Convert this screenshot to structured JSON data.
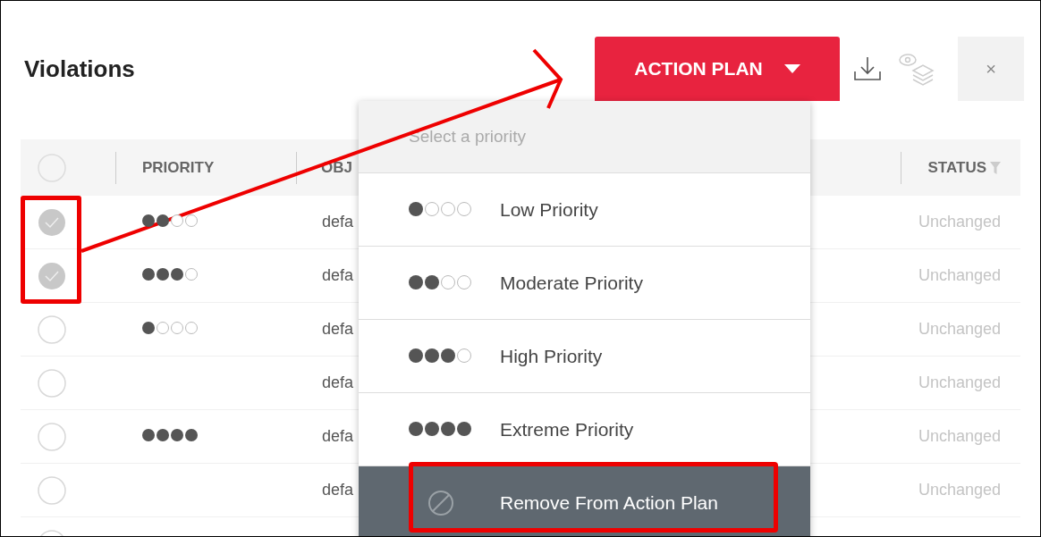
{
  "title": "Violations",
  "toolbar": {
    "action_button": "ACTION PLAN",
    "close": "×"
  },
  "table": {
    "select_all": {
      "checked": false
    },
    "columns": [
      "PRIORITY",
      "OBJ",
      "STATUS"
    ],
    "rows": [
      {
        "checked": true,
        "stars": 2,
        "object": "defa",
        "status": "Unchanged"
      },
      {
        "checked": true,
        "stars": 3,
        "object": "defa",
        "status": "Unchanged"
      },
      {
        "checked": false,
        "stars": 1,
        "object": "defa",
        "status": "Unchanged"
      },
      {
        "checked": false,
        "object": "defa",
        "status": "Unchanged"
      },
      {
        "checked": false,
        "stars": 4,
        "object": "defa",
        "status": "Unchanged"
      },
      {
        "checked": false,
        "object": "defa",
        "status": "Unchanged"
      },
      {
        "checked": false
      }
    ]
  },
  "dropdown": {
    "placeholder": "Select a priority",
    "items": [
      {
        "kind": "priority",
        "stars": 1,
        "label": "Low Priority",
        "selected": false
      },
      {
        "kind": "priority",
        "stars": 2,
        "label": "Moderate Priority",
        "selected": false
      },
      {
        "kind": "priority",
        "stars": 3,
        "label": "High Priority",
        "selected": false
      },
      {
        "kind": "priority",
        "stars": 4,
        "label": "Extreme Priority",
        "selected": false
      },
      {
        "kind": "remove",
        "label": "Remove From Action Plan",
        "selected": true
      }
    ]
  }
}
